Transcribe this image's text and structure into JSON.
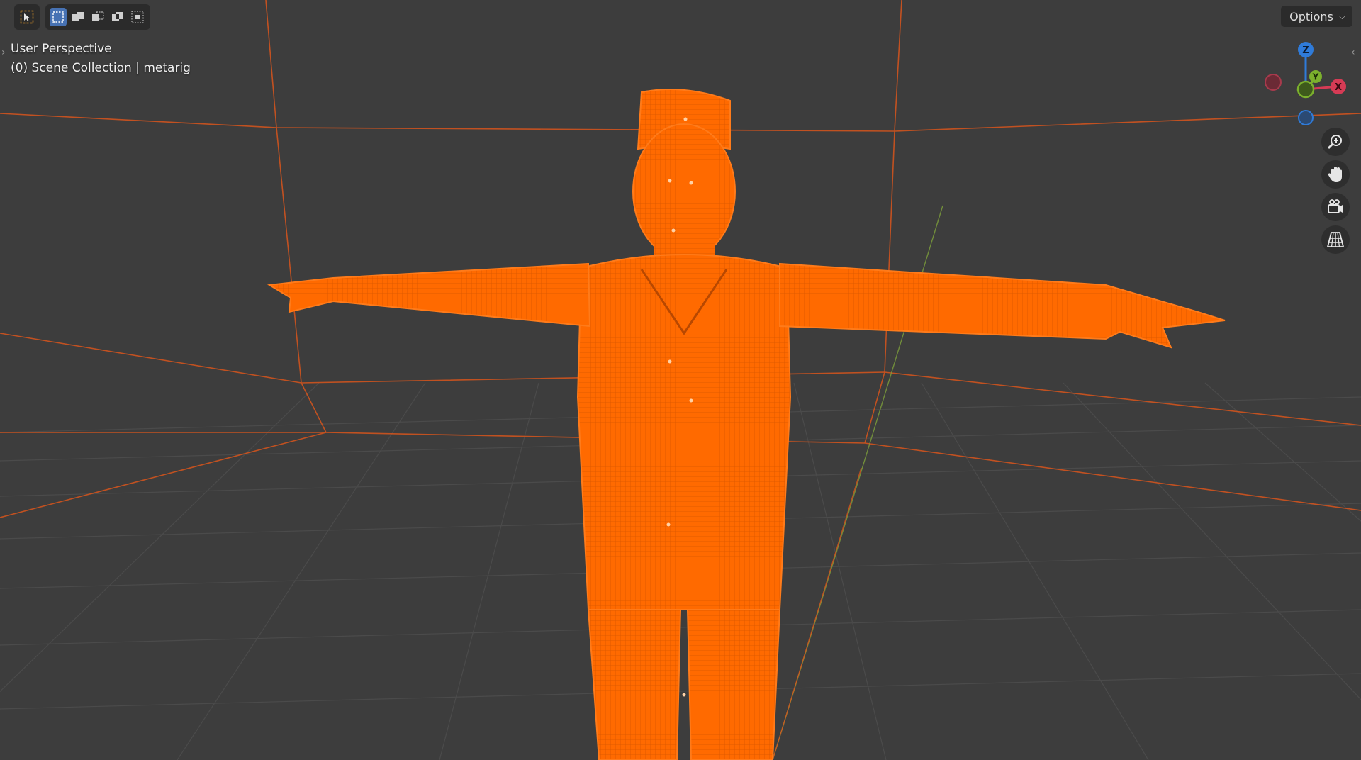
{
  "viewport": {
    "view_name": "User Perspective",
    "context": "(0) Scene Collection | metarig"
  },
  "header": {
    "options_label": "Options",
    "options_chevron": "⌵",
    "select_tool_icon": "cursor-select-icon",
    "mode_icons": [
      "select-new-icon",
      "select-extend-icon",
      "select-subtract-icon",
      "select-difference-icon",
      "select-intersect-icon"
    ]
  },
  "gizmo": {
    "axes": [
      {
        "label": "Z",
        "color": "#2f7bd9"
      },
      {
        "label": "Y",
        "color": "#7bb02d"
      },
      {
        "label": "X",
        "color": "#d63b55"
      }
    ]
  },
  "nav_buttons": [
    "zoom-icon",
    "pan-hand-icon",
    "camera-view-icon",
    "perspective-grid-icon"
  ],
  "colors": {
    "background": "#3d3d3d",
    "selection_orange": "#ff6a00",
    "grid_line": "#4a4a4a"
  }
}
